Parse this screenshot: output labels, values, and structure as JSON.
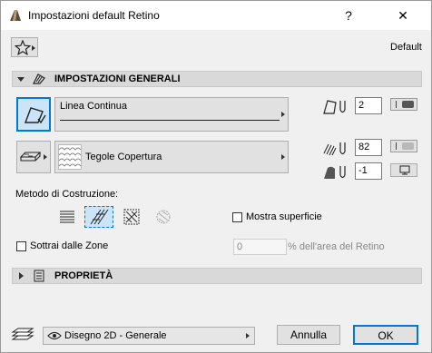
{
  "window": {
    "title": "Impostazioni default Retino",
    "help_label": "?",
    "close_label": "✕"
  },
  "toolbar": {
    "favorites_icon": "star-icon",
    "preset_label": "Default"
  },
  "general_section": {
    "title": "IMPOSTAZIONI GENERALI",
    "line_type": "Linea Continua",
    "fill_type": "Tegole Copertura",
    "pen_value": "2",
    "pattern_pen_value": "82",
    "background_pen_value": "-1",
    "construction_label": "Metodo di Costruzione:",
    "show_surface_label": "Mostra superficie",
    "subtract_zones_label": "Sottrai dalle Zone",
    "zone_percent_value": "0",
    "zone_percent_label": "% dell'area del Retino"
  },
  "properties_section": {
    "title": "PROPRIETÀ"
  },
  "footer": {
    "view_label": "Disegno 2D - Generale",
    "cancel_label": "Annulla",
    "ok_label": "OK"
  },
  "colors": {
    "window_bg": "#f0f0f0",
    "accent": "#0078d7",
    "selected_bg": "#cce4f7"
  }
}
